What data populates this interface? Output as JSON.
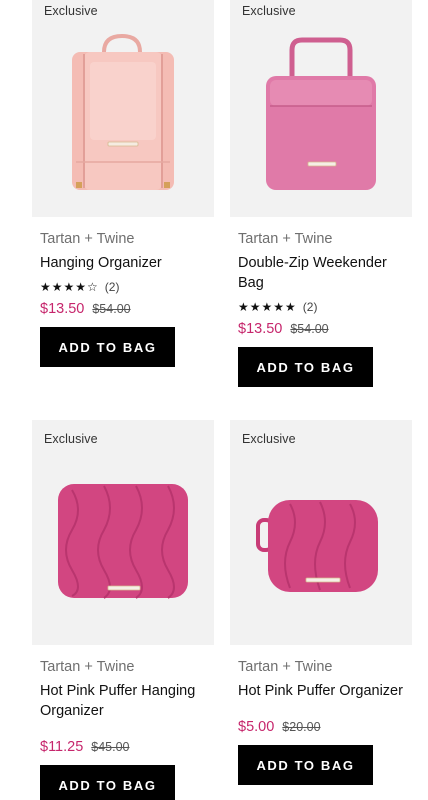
{
  "products": [
    {
      "badge": "Exclusive",
      "brand": "Tartan + Twine",
      "name": "Hanging Organizer",
      "rating_stars": "★★★★☆",
      "rating_value": 4,
      "review_count": "(2)",
      "sale_price": "$13.50",
      "original_price": "$54.00",
      "button_label": "ADD TO BAG",
      "image_icon": "light-pink-hanging-organizer",
      "image_color": "#f4b7b0"
    },
    {
      "badge": "Exclusive",
      "brand": "Tartan + Twine",
      "name": "Double-Zip Weekender Bag",
      "rating_stars": "★★★★★",
      "rating_value": 5,
      "review_count": "(2)",
      "sale_price": "$13.50",
      "original_price": "$54.00",
      "button_label": "ADD TO BAG",
      "image_icon": "pink-weekender-bag",
      "image_color": "#e27aa8"
    },
    {
      "badge": "Exclusive",
      "brand": "Tartan + Twine",
      "name": "Hot Pink Puffer Hanging Organizer",
      "sale_price": "$11.25",
      "original_price": "$45.00",
      "button_label": "ADD TO BAG",
      "image_icon": "hot-pink-puffer-hanging-organizer",
      "image_color": "#d24681"
    },
    {
      "badge": "Exclusive",
      "brand": "Tartan + Twine",
      "name": "Hot Pink Puffer Organizer",
      "sale_price": "$5.00",
      "original_price": "$20.00",
      "button_label": "ADD TO BAG",
      "image_icon": "hot-pink-puffer-organizer",
      "image_color": "#d24681"
    }
  ],
  "colors": {
    "sale_price": "#c6266c",
    "button_bg": "#000000",
    "image_bg": "#f2f2f2"
  }
}
